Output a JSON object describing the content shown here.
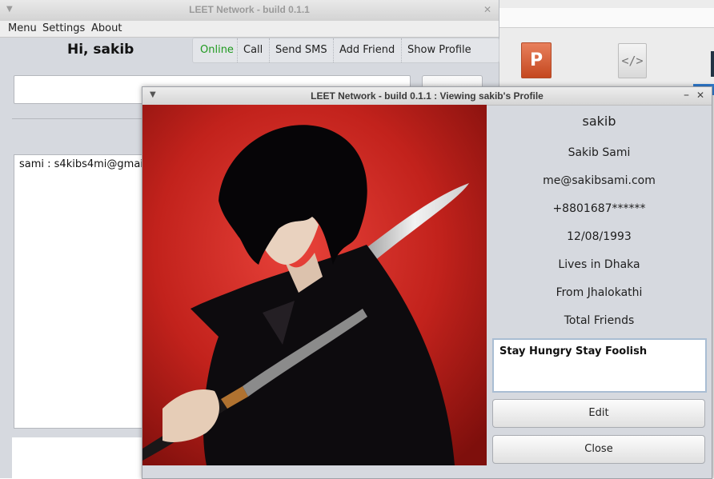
{
  "main_window": {
    "title": "LEET Network - build 0.1.1",
    "menu": [
      "Menu",
      "Settings",
      "About"
    ],
    "greeting": "Hi, sakib",
    "toolbar": {
      "status": "Online",
      "status_color": "#1f9a1f",
      "items": [
        "Call",
        "Send SMS",
        "Add Friend",
        "Show Profile"
      ]
    },
    "list_items": [
      "sami : s4kibs4mi@gmail."
    ]
  },
  "profile_window": {
    "title": "LEET Network - build 0.1.1 : Viewing sakib's Profile",
    "username": "sakib",
    "full_name": "Sakib Sami",
    "email": "me@sakibsami.com",
    "phone": "+8801687******",
    "birthdate": "12/08/1993",
    "lives_in": "Lives in Dhaka",
    "from": "From Jhalokathi",
    "total_friends": "Total Friends",
    "status_message": "Stay Hungry Stay Foolish",
    "edit_button": "Edit",
    "close_button": "Close"
  },
  "icons": {
    "window_menu": "chevron-down-icon",
    "close": "close-icon",
    "minimize": "minimize-icon",
    "powerpoint": "powerpoint-icon",
    "code": "code-icon"
  },
  "colors": {
    "window_bg": "#d6d9df",
    "photo_bg": "#c0201b"
  }
}
